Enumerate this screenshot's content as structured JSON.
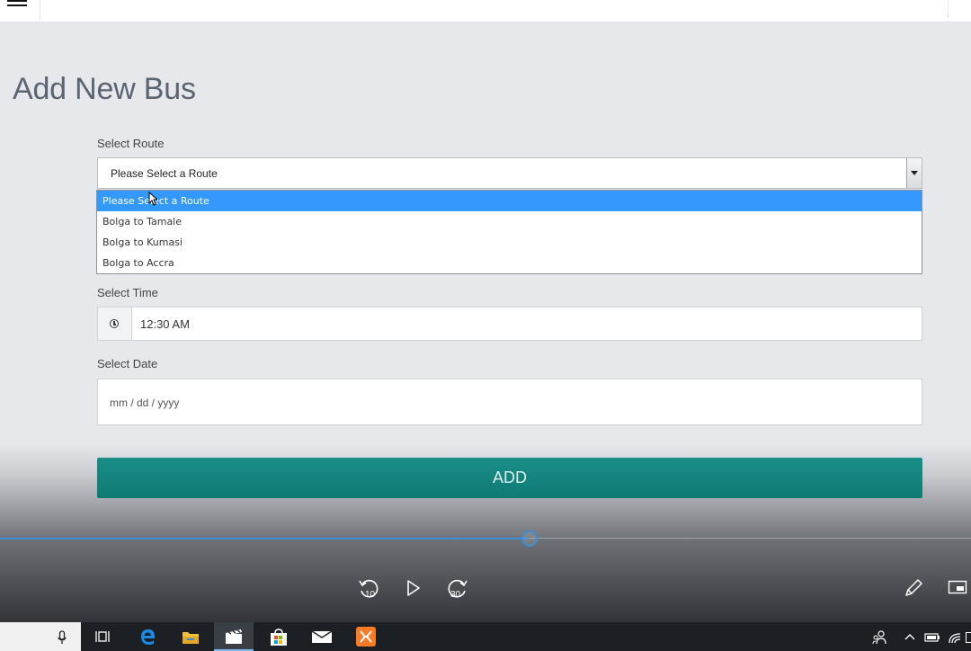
{
  "page": {
    "title": "Add New Bus"
  },
  "form": {
    "route_label": "Select Route",
    "route_value": "Please Select a Route",
    "route_options": [
      "Please Select a Route",
      "Bolga to Tamale",
      "Bolga to Kumasi",
      "Bolga to Accra"
    ],
    "time_label": "Select Time",
    "time_value": "12:30 AM",
    "date_label": "Select Date",
    "date_placeholder": "mm / dd / yyyy",
    "add_label": "ADD"
  },
  "player": {
    "progress": 0.545,
    "rewind_seconds": "10",
    "forward_seconds": "30"
  },
  "icons": {
    "menu": "hamburger-icon",
    "clock": "clock-icon",
    "rewind": "rewind-10-icon",
    "play": "play-icon",
    "forward": "forward-30-icon",
    "pen": "pen-icon",
    "miniplayer": "mini-player-icon",
    "mic": "microphone-icon",
    "taskview": "task-view-icon",
    "edge": "edge-browser-icon",
    "explorer": "file-explorer-icon",
    "movies": "movies-tv-icon",
    "store": "store-icon",
    "mail": "mail-icon",
    "xampp": "xampp-icon"
  },
  "colors": {
    "accent": "#1a8f88",
    "option_highlight": "#3399ff",
    "seek": "#3a8fd8"
  }
}
